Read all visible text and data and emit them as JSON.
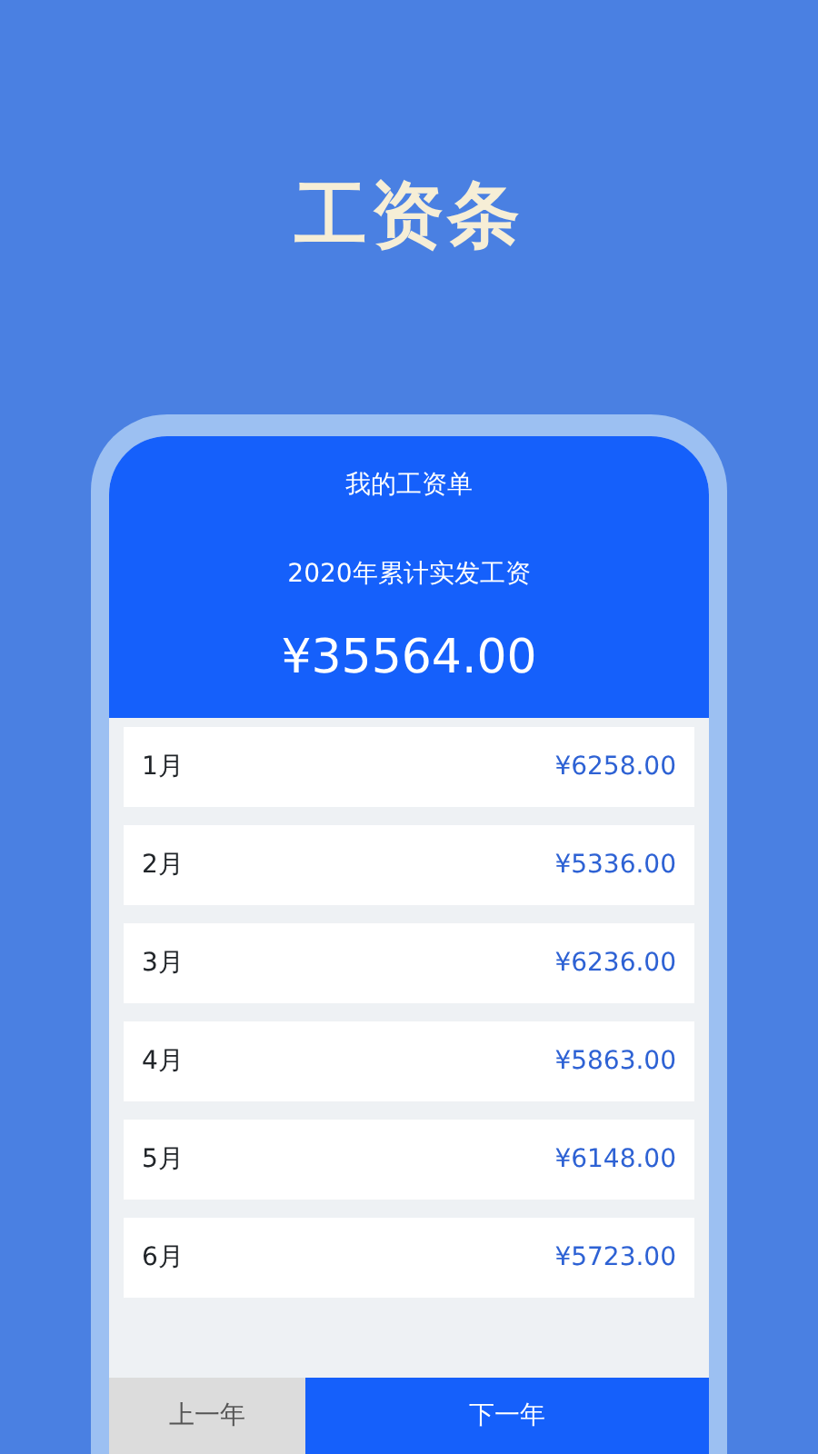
{
  "headline": "工资条",
  "screen": {
    "title": "我的工资单",
    "summary_label": "2020年累计实发工资",
    "summary_amount": "¥35564.00",
    "months": [
      {
        "month": "1月",
        "amount": "¥6258.00"
      },
      {
        "month": "2月",
        "amount": "¥5336.00"
      },
      {
        "month": "3月",
        "amount": "¥6236.00"
      },
      {
        "month": "4月",
        "amount": "¥5863.00"
      },
      {
        "month": "5月",
        "amount": "¥6148.00"
      },
      {
        "month": "6月",
        "amount": "¥5723.00"
      }
    ],
    "buttons": [
      {
        "label": "上一年",
        "kind": "secondary"
      },
      {
        "label": "下一年",
        "kind": "primary"
      }
    ]
  }
}
